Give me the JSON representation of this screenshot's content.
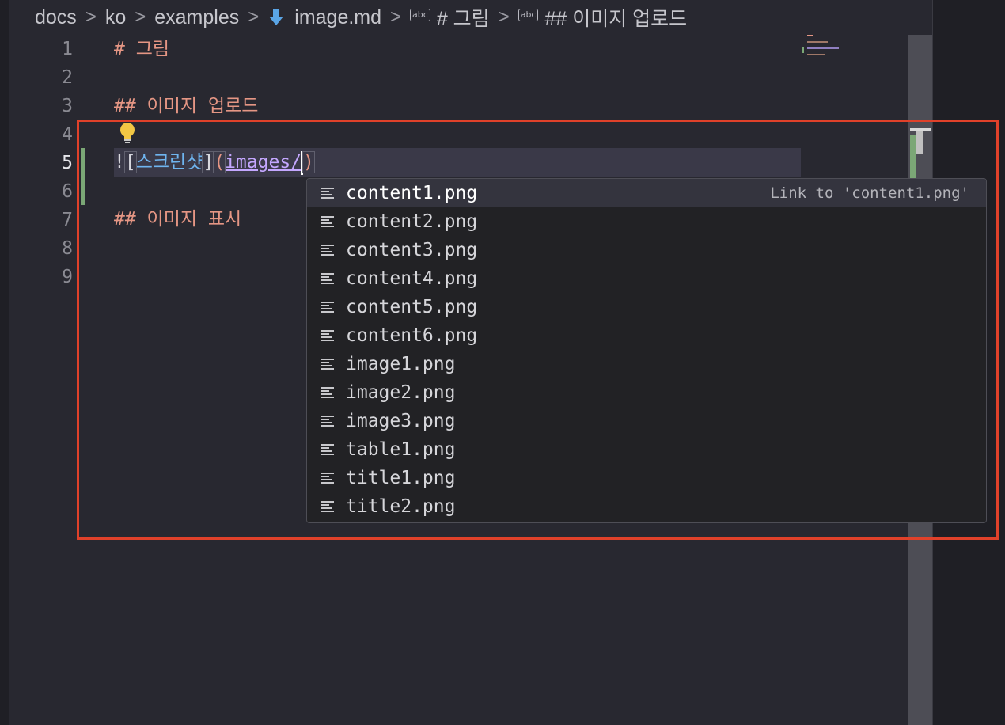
{
  "breadcrumb": {
    "items": [
      "docs",
      "ko",
      "examples",
      "image.md",
      "# 그림",
      "## 이미지 업로드"
    ],
    "separator": ">",
    "abc_icon_text": "abc"
  },
  "editor": {
    "line_numbers": [
      "1",
      "2",
      "3",
      "4",
      "5",
      "6",
      "7",
      "8",
      "9"
    ],
    "active_line": "5",
    "line1": "# 그림",
    "line3": "## 이미지 업로드",
    "line5": {
      "bang": "!",
      "lbracket": "[",
      "alt": "스크린샷",
      "rbracket": "]",
      "lparen": "(",
      "path": "images/",
      "rparen": ")"
    },
    "line7": "## 이미지 표시"
  },
  "suggestions": {
    "items": [
      "content1.png",
      "content2.png",
      "content3.png",
      "content4.png",
      "content5.png",
      "content6.png",
      "image1.png",
      "image2.png",
      "image3.png",
      "table1.png",
      "title1.png",
      "title2.png"
    ],
    "selected_detail": "Link to 'content1.png'"
  },
  "colors": {
    "heading": "#e59684",
    "alt_text": "#6fb5f0",
    "link_path": "#c4a7ff",
    "highlight_box": "#e0412a",
    "git_added": "#7ba776",
    "lightbulb": "#f2c744"
  },
  "icons": {
    "breadcrumb_file": "markdown-icon",
    "breadcrumb_symbol": "abc-symbol-icon",
    "suggestion": "file-text-icon",
    "quick_fix": "lightbulb-icon"
  }
}
